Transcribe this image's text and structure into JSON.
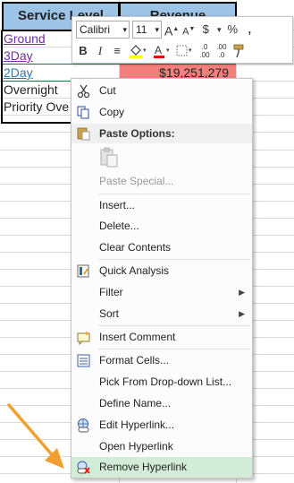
{
  "sheet": {
    "headers": {
      "service_level": "Service Level",
      "revenue": "Revenue"
    },
    "rows": [
      {
        "service": "Ground"
      },
      {
        "service": "3Day"
      },
      {
        "service": "2Day",
        "revenue": "$19,251,279"
      },
      {
        "service": "Overnight"
      },
      {
        "service": "Priority Ove"
      }
    ]
  },
  "mini_toolbar": {
    "font_name": "Calibri",
    "font_size": "11",
    "grow_font": "A",
    "shrink_font": "A",
    "currency": "$",
    "currency_arrow": "▾",
    "percent": "%",
    "comma": ",",
    "bold": "B",
    "italic": "I",
    "align": "≡",
    "font_color_letter": "A",
    "fill_color": "#ffff00",
    "font_color": "#ff0000"
  },
  "context_menu": {
    "items": [
      {
        "label": "Cut",
        "icon": "scissors-icon"
      },
      {
        "label": "Copy",
        "icon": "copy-icon"
      },
      {
        "label": "Paste Options:",
        "icon": "paste-icon"
      },
      {
        "label": "Paste Special...",
        "disabled": true
      },
      {
        "label": "Insert..."
      },
      {
        "label": "Delete..."
      },
      {
        "label": "Clear Contents"
      },
      {
        "label": "Quick Analysis",
        "icon": "quick-analysis-icon"
      },
      {
        "label": "Filter",
        "submenu": "▶"
      },
      {
        "label": "Sort",
        "submenu": "▶"
      },
      {
        "label": "Insert Comment",
        "icon": "comment-icon"
      },
      {
        "label": "Format Cells...",
        "icon": "format-cells-icon"
      },
      {
        "label": "Pick From Drop-down List..."
      },
      {
        "label": "Define Name..."
      },
      {
        "label": "Edit Hyperlink...",
        "icon": "edit-hyperlink-icon"
      },
      {
        "label": "Open Hyperlink"
      },
      {
        "label": "Remove Hyperlink",
        "icon": "remove-hyperlink-icon",
        "highlighted": true
      }
    ]
  },
  "colors": {
    "header_fill": "#9dc3e6",
    "revenue_fill": "#f4807e",
    "highlight": "#d2ecd8",
    "arrow": "#f0a030"
  }
}
